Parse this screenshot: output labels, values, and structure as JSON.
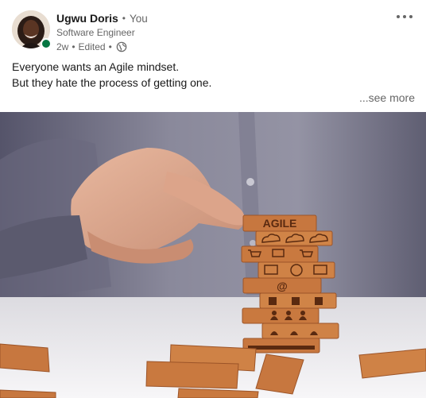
{
  "post": {
    "author_name": "Ugwu Doris",
    "separator": "•",
    "relation": "You",
    "headline": "Software Engineer",
    "time_ago": "2w",
    "edited_label": "Edited",
    "visibility_icon": "globe-icon",
    "text_line1": "Everyone wants an Agile mindset.",
    "text_line2": "But they hate the process of getting one.",
    "see_more": "...see more",
    "more_icon": "more-horizontal-icon"
  },
  "media": {
    "block_label": "AGILE",
    "at_symbol": "@",
    "colors": {
      "background": "#7b7a8c",
      "table": "#f2f1f3",
      "wood": "#c7773f",
      "wood_dark": "#9c5428",
      "online": "#057642"
    }
  }
}
